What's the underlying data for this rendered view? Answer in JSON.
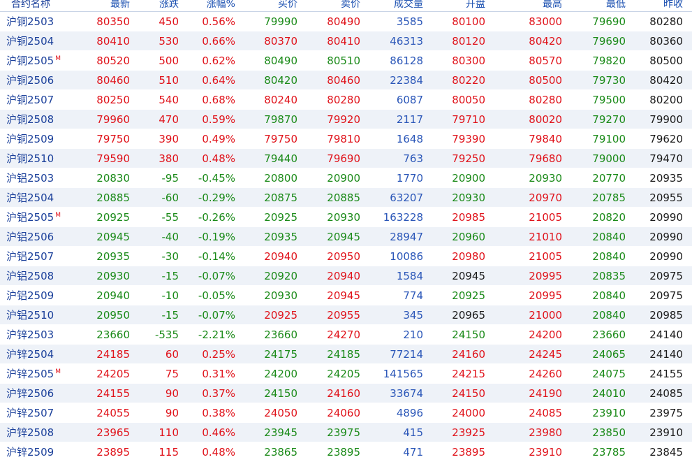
{
  "columns": [
    "合约名称",
    "最新",
    "涨跌",
    "涨幅%",
    "买价",
    "卖价",
    "成交量",
    "开盘",
    "最高",
    "最低",
    "昨收"
  ],
  "rows": [
    {
      "name": "沪铜2503",
      "mark": "",
      "latest": "80350",
      "change": "450",
      "pct": "0.56%",
      "bid": "79990",
      "ask": "80490",
      "volume": "3585",
      "open": "80100",
      "high": "83000",
      "low": "79690",
      "prev": "80280",
      "colors": {
        "latest": "red",
        "change": "red",
        "pct": "red",
        "bid": "green",
        "ask": "red",
        "open": "red",
        "high": "red",
        "low": "green"
      }
    },
    {
      "name": "沪铜2504",
      "mark": "",
      "latest": "80410",
      "change": "530",
      "pct": "0.66%",
      "bid": "80370",
      "ask": "80410",
      "volume": "46313",
      "open": "80120",
      "high": "80420",
      "low": "79690",
      "prev": "80360",
      "colors": {
        "latest": "red",
        "change": "red",
        "pct": "red",
        "bid": "red",
        "ask": "red",
        "open": "red",
        "high": "red",
        "low": "green"
      }
    },
    {
      "name": "沪铜2505",
      "mark": "M",
      "latest": "80520",
      "change": "500",
      "pct": "0.62%",
      "bid": "80490",
      "ask": "80510",
      "volume": "86128",
      "open": "80300",
      "high": "80570",
      "low": "79820",
      "prev": "80500",
      "colors": {
        "latest": "red",
        "change": "red",
        "pct": "red",
        "bid": "green",
        "ask": "green",
        "open": "red",
        "high": "red",
        "low": "green"
      }
    },
    {
      "name": "沪铜2506",
      "mark": "",
      "latest": "80460",
      "change": "510",
      "pct": "0.64%",
      "bid": "80420",
      "ask": "80460",
      "volume": "22384",
      "open": "80220",
      "high": "80500",
      "low": "79730",
      "prev": "80420",
      "colors": {
        "latest": "red",
        "change": "red",
        "pct": "red",
        "bid": "green",
        "ask": "red",
        "open": "red",
        "high": "red",
        "low": "green"
      }
    },
    {
      "name": "沪铜2507",
      "mark": "",
      "latest": "80250",
      "change": "540",
      "pct": "0.68%",
      "bid": "80240",
      "ask": "80280",
      "volume": "6087",
      "open": "80050",
      "high": "80280",
      "low": "79500",
      "prev": "80200",
      "colors": {
        "latest": "red",
        "change": "red",
        "pct": "red",
        "bid": "red",
        "ask": "red",
        "open": "red",
        "high": "red",
        "low": "green"
      }
    },
    {
      "name": "沪铜2508",
      "mark": "",
      "latest": "79960",
      "change": "470",
      "pct": "0.59%",
      "bid": "79870",
      "ask": "79920",
      "volume": "2117",
      "open": "79710",
      "high": "80020",
      "low": "79270",
      "prev": "79900",
      "colors": {
        "latest": "red",
        "change": "red",
        "pct": "red",
        "bid": "green",
        "ask": "red",
        "open": "red",
        "high": "red",
        "low": "green"
      }
    },
    {
      "name": "沪铜2509",
      "mark": "",
      "latest": "79750",
      "change": "390",
      "pct": "0.49%",
      "bid": "79750",
      "ask": "79810",
      "volume": "1648",
      "open": "79390",
      "high": "79840",
      "low": "79100",
      "prev": "79620",
      "colors": {
        "latest": "red",
        "change": "red",
        "pct": "red",
        "bid": "red",
        "ask": "red",
        "open": "red",
        "high": "red",
        "low": "green"
      }
    },
    {
      "name": "沪铜2510",
      "mark": "",
      "latest": "79590",
      "change": "380",
      "pct": "0.48%",
      "bid": "79440",
      "ask": "79690",
      "volume": "763",
      "open": "79250",
      "high": "79680",
      "low": "79000",
      "prev": "79470",
      "colors": {
        "latest": "red",
        "change": "red",
        "pct": "red",
        "bid": "green",
        "ask": "red",
        "open": "red",
        "high": "red",
        "low": "green"
      }
    },
    {
      "name": "沪铝2503",
      "mark": "",
      "latest": "20830",
      "change": "-95",
      "pct": "-0.45%",
      "bid": "20800",
      "ask": "20900",
      "volume": "1770",
      "open": "20900",
      "high": "20930",
      "low": "20770",
      "prev": "20935",
      "colors": {
        "latest": "green",
        "change": "green",
        "pct": "green",
        "bid": "green",
        "ask": "green",
        "open": "green",
        "high": "green",
        "low": "green"
      }
    },
    {
      "name": "沪铝2504",
      "mark": "",
      "latest": "20885",
      "change": "-60",
      "pct": "-0.29%",
      "bid": "20875",
      "ask": "20885",
      "volume": "63207",
      "open": "20930",
      "high": "20970",
      "low": "20785",
      "prev": "20955",
      "colors": {
        "latest": "green",
        "change": "green",
        "pct": "green",
        "bid": "green",
        "ask": "green",
        "open": "green",
        "high": "red",
        "low": "green"
      }
    },
    {
      "name": "沪铝2505",
      "mark": "M",
      "latest": "20925",
      "change": "-55",
      "pct": "-0.26%",
      "bid": "20925",
      "ask": "20930",
      "volume": "163228",
      "open": "20985",
      "high": "21005",
      "low": "20820",
      "prev": "20990",
      "colors": {
        "latest": "green",
        "change": "green",
        "pct": "green",
        "bid": "green",
        "ask": "green",
        "open": "red",
        "high": "red",
        "low": "green"
      }
    },
    {
      "name": "沪铝2506",
      "mark": "",
      "latest": "20945",
      "change": "-40",
      "pct": "-0.19%",
      "bid": "20935",
      "ask": "20945",
      "volume": "28947",
      "open": "20960",
      "high": "21010",
      "low": "20840",
      "prev": "20990",
      "colors": {
        "latest": "green",
        "change": "green",
        "pct": "green",
        "bid": "green",
        "ask": "green",
        "open": "green",
        "high": "red",
        "low": "green"
      }
    },
    {
      "name": "沪铝2507",
      "mark": "",
      "latest": "20935",
      "change": "-30",
      "pct": "-0.14%",
      "bid": "20940",
      "ask": "20950",
      "volume": "10086",
      "open": "20980",
      "high": "21005",
      "low": "20840",
      "prev": "20990",
      "colors": {
        "latest": "green",
        "change": "green",
        "pct": "green",
        "bid": "red",
        "ask": "red",
        "open": "red",
        "high": "red",
        "low": "green"
      }
    },
    {
      "name": "沪铝2508",
      "mark": "",
      "latest": "20930",
      "change": "-15",
      "pct": "-0.07%",
      "bid": "20920",
      "ask": "20940",
      "volume": "1584",
      "open": "20945",
      "high": "20995",
      "low": "20835",
      "prev": "20975",
      "colors": {
        "latest": "green",
        "change": "green",
        "pct": "green",
        "bid": "green",
        "ask": "red",
        "open": "black",
        "high": "red",
        "low": "green"
      }
    },
    {
      "name": "沪铝2509",
      "mark": "",
      "latest": "20940",
      "change": "-10",
      "pct": "-0.05%",
      "bid": "20930",
      "ask": "20945",
      "volume": "774",
      "open": "20925",
      "high": "20995",
      "low": "20840",
      "prev": "20975",
      "colors": {
        "latest": "green",
        "change": "green",
        "pct": "green",
        "bid": "green",
        "ask": "red",
        "open": "green",
        "high": "red",
        "low": "green"
      }
    },
    {
      "name": "沪铝2510",
      "mark": "",
      "latest": "20950",
      "change": "-15",
      "pct": "-0.07%",
      "bid": "20925",
      "ask": "20955",
      "volume": "345",
      "open": "20965",
      "high": "21000",
      "low": "20840",
      "prev": "20985",
      "colors": {
        "latest": "green",
        "change": "green",
        "pct": "green",
        "bid": "red",
        "ask": "red",
        "open": "black",
        "high": "red",
        "low": "green"
      }
    },
    {
      "name": "沪锌2503",
      "mark": "",
      "latest": "23660",
      "change": "-535",
      "pct": "-2.21%",
      "bid": "23660",
      "ask": "24270",
      "volume": "210",
      "open": "24150",
      "high": "24200",
      "low": "23660",
      "prev": "24140",
      "colors": {
        "latest": "green",
        "change": "green",
        "pct": "green",
        "bid": "green",
        "ask": "red",
        "open": "green",
        "high": "red",
        "low": "green"
      }
    },
    {
      "name": "沪锌2504",
      "mark": "",
      "latest": "24185",
      "change": "60",
      "pct": "0.25%",
      "bid": "24175",
      "ask": "24185",
      "volume": "77214",
      "open": "24160",
      "high": "24245",
      "low": "24065",
      "prev": "24140",
      "colors": {
        "latest": "red",
        "change": "red",
        "pct": "red",
        "bid": "green",
        "ask": "green",
        "open": "red",
        "high": "red",
        "low": "green"
      }
    },
    {
      "name": "沪锌2505",
      "mark": "M",
      "latest": "24205",
      "change": "75",
      "pct": "0.31%",
      "bid": "24200",
      "ask": "24205",
      "volume": "141565",
      "open": "24215",
      "high": "24260",
      "low": "24075",
      "prev": "24155",
      "colors": {
        "latest": "red",
        "change": "red",
        "pct": "red",
        "bid": "green",
        "ask": "green",
        "open": "red",
        "high": "red",
        "low": "green"
      }
    },
    {
      "name": "沪锌2506",
      "mark": "",
      "latest": "24155",
      "change": "90",
      "pct": "0.37%",
      "bid": "24150",
      "ask": "24160",
      "volume": "33674",
      "open": "24150",
      "high": "24190",
      "low": "24010",
      "prev": "24085",
      "colors": {
        "latest": "red",
        "change": "red",
        "pct": "red",
        "bid": "green",
        "ask": "red",
        "open": "red",
        "high": "red",
        "low": "green"
      }
    },
    {
      "name": "沪锌2507",
      "mark": "",
      "latest": "24055",
      "change": "90",
      "pct": "0.38%",
      "bid": "24050",
      "ask": "24060",
      "volume": "4896",
      "open": "24000",
      "high": "24085",
      "low": "23910",
      "prev": "23975",
      "colors": {
        "latest": "red",
        "change": "red",
        "pct": "red",
        "bid": "red",
        "ask": "red",
        "open": "red",
        "high": "red",
        "low": "green"
      }
    },
    {
      "name": "沪锌2508",
      "mark": "",
      "latest": "23965",
      "change": "110",
      "pct": "0.46%",
      "bid": "23945",
      "ask": "23975",
      "volume": "415",
      "open": "23925",
      "high": "23980",
      "low": "23850",
      "prev": "23910",
      "colors": {
        "latest": "red",
        "change": "red",
        "pct": "red",
        "bid": "green",
        "ask": "green",
        "open": "red",
        "high": "red",
        "low": "green"
      }
    },
    {
      "name": "沪锌2509",
      "mark": "",
      "latest": "23895",
      "change": "115",
      "pct": "0.48%",
      "bid": "23865",
      "ask": "23895",
      "volume": "471",
      "open": "23895",
      "high": "23910",
      "low": "23785",
      "prev": "23845",
      "colors": {
        "latest": "red",
        "change": "red",
        "pct": "red",
        "bid": "green",
        "ask": "green",
        "open": "red",
        "high": "red",
        "low": "green"
      }
    }
  ],
  "theme": {
    "up": "#e0121a",
    "down": "#1a8a18",
    "volume": "#2a56b8",
    "header": "#1a4fb0",
    "row_alt": "#eef2f8"
  }
}
